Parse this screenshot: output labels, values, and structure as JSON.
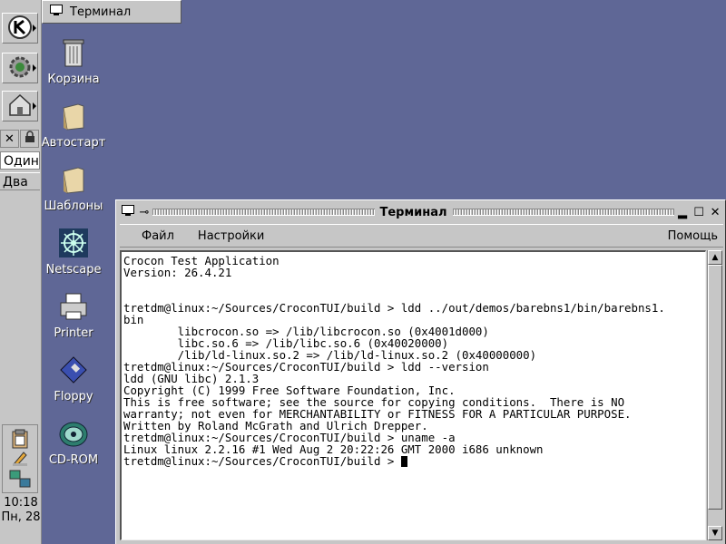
{
  "taskbar": {
    "task_label": "Терминал"
  },
  "panel": {
    "desktops": [
      "Один",
      "Два"
    ],
    "clock_time": "10:18",
    "clock_date": "Пн, 28"
  },
  "desktop_icons": [
    {
      "label": "Корзина",
      "icon": "trash-icon"
    },
    {
      "label": "Автостарт",
      "icon": "folder-icon"
    },
    {
      "label": "Шаблоны",
      "icon": "folder-icon"
    },
    {
      "label": "Netscape",
      "icon": "netscape-icon"
    },
    {
      "label": "Printer",
      "icon": "printer-icon"
    },
    {
      "label": "Floppy",
      "icon": "floppy-icon"
    },
    {
      "label": "CD-ROM",
      "icon": "cdrom-icon"
    }
  ],
  "window": {
    "title": "Терминал",
    "menu": {
      "file": "Файл",
      "settings": "Настройки",
      "help": "Помощь"
    },
    "terminal_lines": [
      "Crocon Test Application",
      "Version: 26.4.21",
      "",
      "",
      "tretdm@linux:~/Sources/CroconTUI/build > ldd ../out/demos/barebns1/bin/barebns1.",
      "bin",
      "        libcrocon.so => /lib/libcrocon.so (0x4001d000)",
      "        libc.so.6 => /lib/libc.so.6 (0x40020000)",
      "        /lib/ld-linux.so.2 => /lib/ld-linux.so.2 (0x40000000)",
      "tretdm@linux:~/Sources/CroconTUI/build > ldd --version",
      "ldd (GNU libc) 2.1.3",
      "Copyright (C) 1999 Free Software Foundation, Inc.",
      "This is free software; see the source for copying conditions.  There is NO",
      "warranty; not even for MERCHANTABILITY or FITNESS FOR A PARTICULAR PURPOSE.",
      "Written by Roland McGrath and Ulrich Drepper.",
      "tretdm@linux:~/Sources/CroconTUI/build > uname -a",
      "Linux linux 2.2.16 #1 Wed Aug 2 20:22:26 GMT 2000 i686 unknown"
    ],
    "prompt": "tretdm@linux:~/Sources/CroconTUI/build > "
  }
}
